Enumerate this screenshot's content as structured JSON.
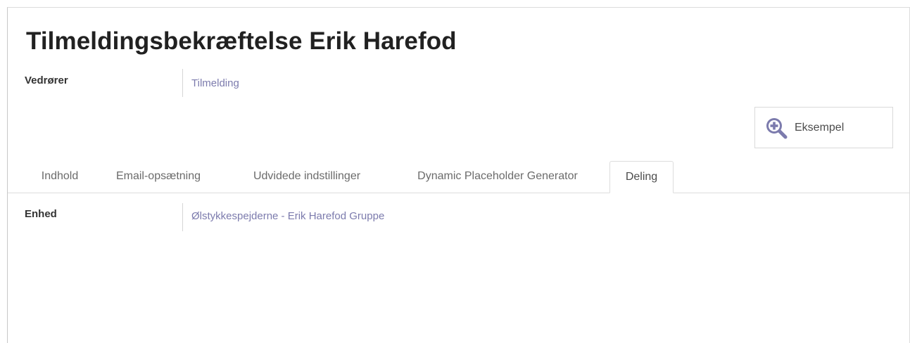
{
  "page": {
    "title": "Tilmeldingsbekræftelse Erik Harefod"
  },
  "fields": {
    "vedrorer": {
      "label": "Vedrører",
      "value": "Tilmelding"
    },
    "enhed": {
      "label": "Enhed",
      "value": "Ølstykkespejderne - Erik Harefod Gruppe"
    }
  },
  "preview_button": {
    "label": "Eksempel",
    "icon": "zoom-in-icon"
  },
  "tabs": [
    {
      "label": "Indhold",
      "active": false
    },
    {
      "label": "Email-opsætning",
      "active": false
    },
    {
      "label": "Udvidede indstillinger",
      "active": false
    },
    {
      "label": "Dynamic Placeholder Generator",
      "active": false
    },
    {
      "label": "Deling",
      "active": true
    }
  ],
  "colors": {
    "link": "#7c7bad",
    "icon": "#7c7bad",
    "title": "#212121"
  }
}
